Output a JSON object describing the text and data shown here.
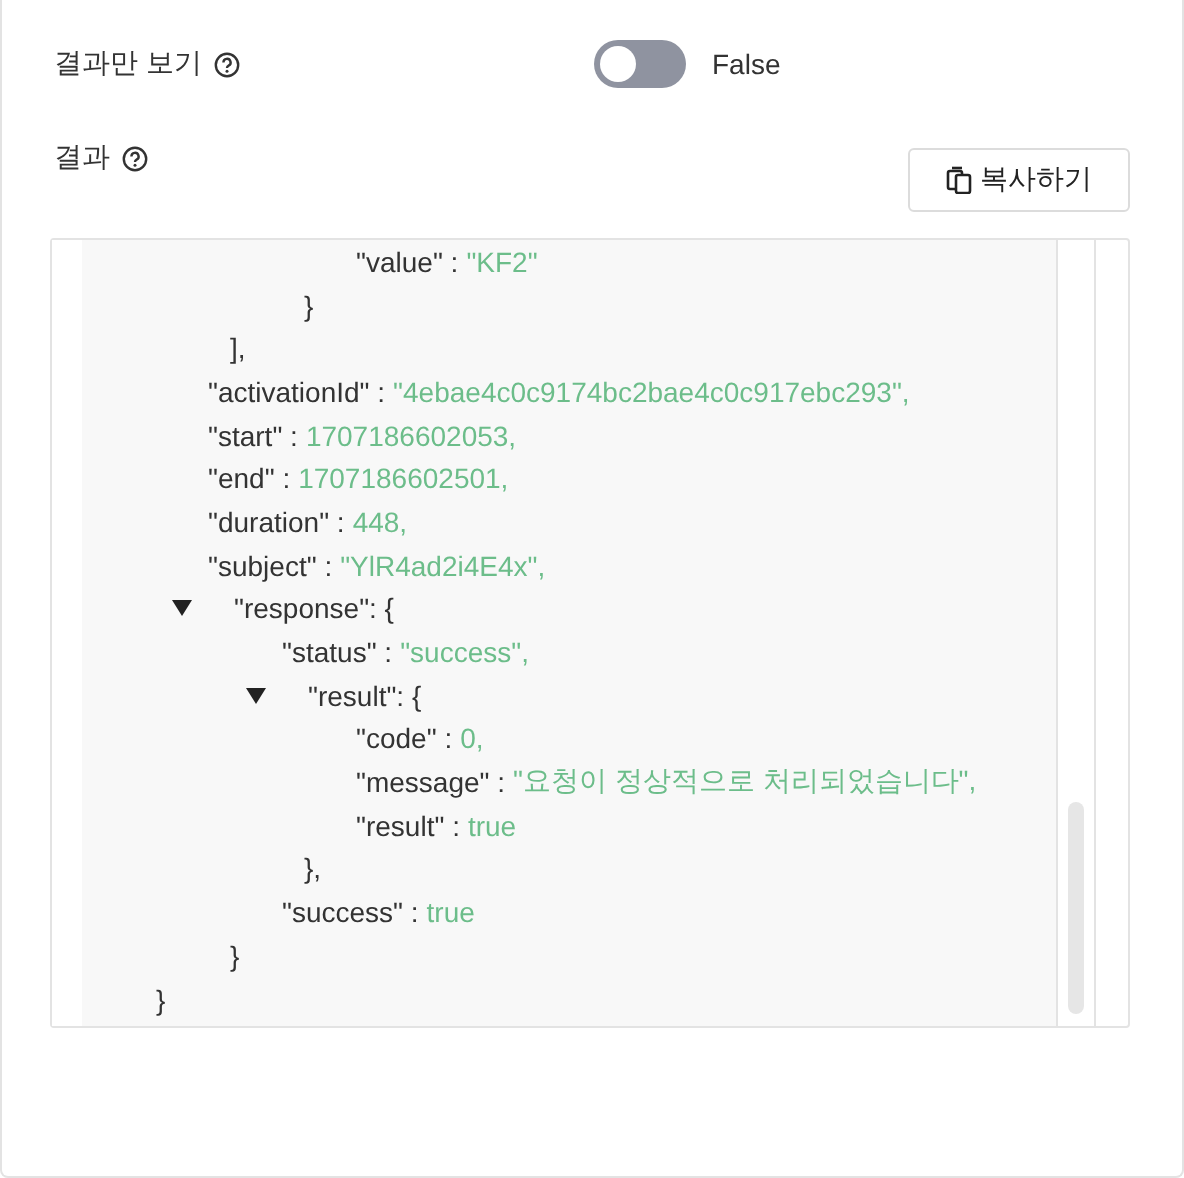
{
  "settings": [
    {
      "label": "결과만 보기",
      "toggle": {
        "on": false,
        "text": "False"
      }
    }
  ],
  "result": {
    "label": "결과",
    "copy_button": "복사하기",
    "tree": {
      "kind": "fragment",
      "close": "}",
      "children": [
        {
          "kind": "fragment",
          "close": "],",
          "children": [
            {
              "kind": "fragment",
              "close": "}",
              "children": [
                {
                  "kind": "pair",
                  "key": "\"value\" :",
                  "value": "\"KF2\""
                }
              ]
            }
          ]
        },
        {
          "kind": "pair",
          "key": "\"activationId\" :",
          "value": "\"4ebae4c0c9174bc2bae4c0c917ebc293\","
        },
        {
          "kind": "pair",
          "key": "\"start\" :",
          "value": "1707186602053,"
        },
        {
          "kind": "pair",
          "key": "\"end\" :",
          "value": "1707186602501,"
        },
        {
          "kind": "pair",
          "key": "\"duration\" :",
          "value": "448,"
        },
        {
          "kind": "pair",
          "key": "\"subject\" :",
          "value": "\"YlR4ad2i4E4x\","
        },
        {
          "kind": "object",
          "head": "\"response\": {",
          "expanded": true,
          "close": "}",
          "children": [
            {
              "kind": "pair",
              "key": "\"status\" :",
              "value": "\"success\","
            },
            {
              "kind": "object",
              "head": "\"result\": {",
              "expanded": true,
              "close": "},",
              "children": [
                {
                  "kind": "pair",
                  "key": "\"code\" :",
                  "value": "0,"
                },
                {
                  "kind": "pair",
                  "key": "\"message\" :",
                  "value": "\"요청이 정상적으로 처리되었습니다\","
                },
                {
                  "kind": "pair",
                  "key": "\"result\" :",
                  "value": "true"
                }
              ]
            },
            {
              "kind": "pair",
              "key": "\"success\" :",
              "value": "true"
            }
          ]
        }
      ]
    }
  }
}
